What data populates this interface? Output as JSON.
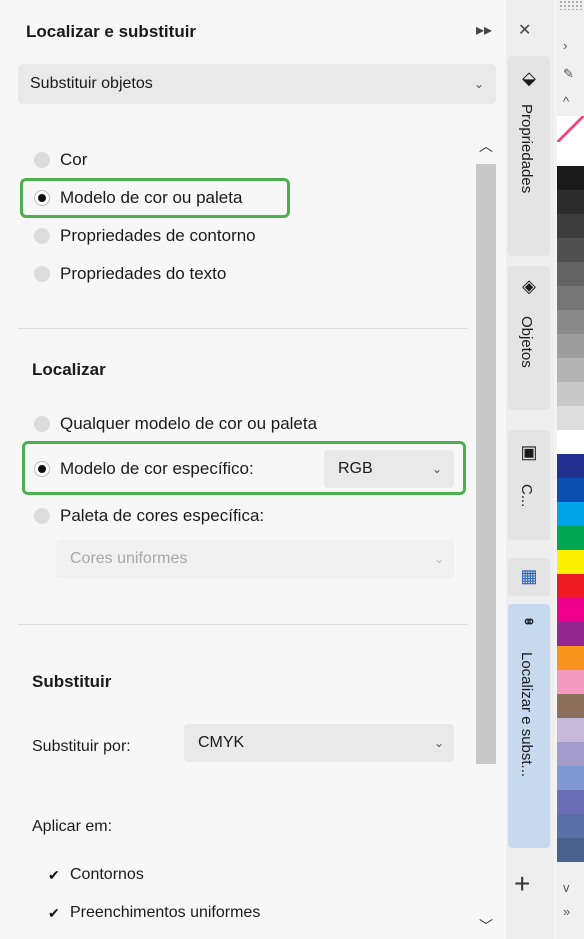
{
  "panel": {
    "title": "Localizar e substituir",
    "expand_icon": "▸▸",
    "close_icon": "✕",
    "mode": "Substituir objetos"
  },
  "find_options": {
    "items": [
      "Cor",
      "Modelo de cor ou paleta",
      "Propriedades de contorno",
      "Propriedades do texto"
    ],
    "selected_index": 1
  },
  "localizar": {
    "heading": "Localizar",
    "any": "Qualquer modelo de cor ou paleta",
    "specific_model": "Modelo de cor específico:",
    "specific_model_value": "RGB",
    "specific_palette": "Paleta de cores específica:",
    "palette_value": "Cores uniformes",
    "selected_index": 1
  },
  "substituir": {
    "heading": "Substituir",
    "replace_by_label": "Substituir por:",
    "replace_by_value": "CMYK",
    "apply_label": "Aplicar em:",
    "apply_items": [
      {
        "label": "Contornos",
        "checked": true
      },
      {
        "label": "Preenchimentos uniformes",
        "checked": true
      }
    ]
  },
  "tabs": [
    {
      "label": "Propriedades",
      "icon": "properties-icon"
    },
    {
      "label": "Objetos",
      "icon": "layers-icon"
    },
    {
      "label": "C...",
      "icon": "frame-icon"
    },
    {
      "label": "",
      "icon": "palette-grid-icon"
    },
    {
      "label": "Localizar e subst...",
      "icon": "binoculars-icon"
    }
  ],
  "colors": {
    "highlight": "#4caf50",
    "active_tab": "#c7d9ee",
    "palette": [
      "#ffffff",
      "#1a1a1a",
      "#2b2b2b",
      "#3d3d3d",
      "#505050",
      "#636363",
      "#767676",
      "#8a8a8a",
      "#9e9e9e",
      "#b3b3b3",
      "#c8c8c8",
      "#dddddd",
      "#ffffff",
      "#23308f",
      "#0a4fb0",
      "#00a2e8",
      "#00a651",
      "#fff200",
      "#ed1c24",
      "#ec008c",
      "#92278f",
      "#f7941d",
      "#f49ac1",
      "#8b6f5a",
      "#c7b9d9",
      "#a39bc9",
      "#7f98d1",
      "#6b6eb5",
      "#5a6fa6",
      "#49618d",
      "#34476d",
      "#2b3a57"
    ]
  }
}
